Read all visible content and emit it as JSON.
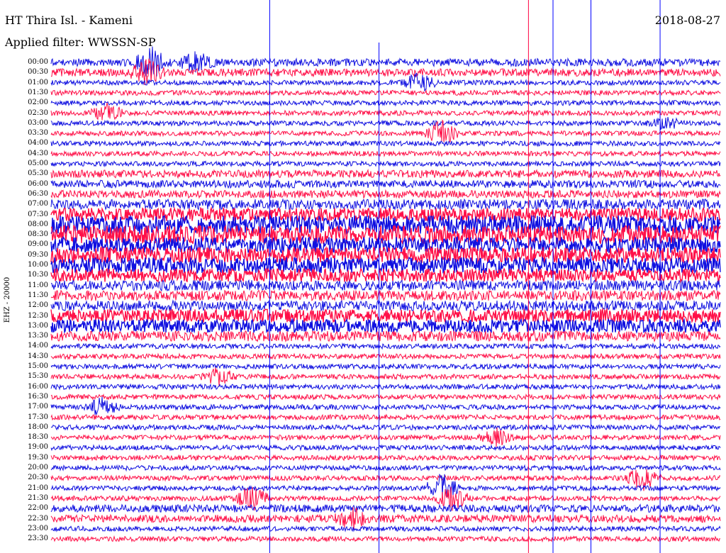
{
  "header": {
    "station": "HT Thira Isl. - Kameni",
    "filter": "Applied filter: WWSSN-SP",
    "date": "2018-08-27"
  },
  "axis": {
    "channel_label": "EHZ - 20000"
  },
  "colors": {
    "blue_trace": "#1010e0",
    "red_trace": "#ff1048",
    "blue_marker": "#0000ff",
    "red_marker": "#ff0040"
  },
  "chart_data": {
    "type": "line",
    "title": "HT Thira Isl. - Kameni",
    "subtitle": "Applied filter: WWSSN-SP",
    "xlabel": "",
    "ylabel": "EHZ - 20000",
    "x_range_minutes": [
      0,
      30
    ],
    "grid": false,
    "legend": "none",
    "rows": [
      "00:00",
      "00:30",
      "01:00",
      "01:30",
      "02:00",
      "02:30",
      "03:00",
      "03:30",
      "04:00",
      "04:30",
      "05:00",
      "05:30",
      "06:00",
      "06:30",
      "07:00",
      "07:30",
      "08:00",
      "08:30",
      "09:00",
      "09:30",
      "10:00",
      "10:30",
      "11:00",
      "11:30",
      "12:00",
      "12:30",
      "13:00",
      "13:30",
      "14:00",
      "14:30",
      "15:00",
      "15:30",
      "16:00",
      "16:30",
      "17:00",
      "17:30",
      "18:00",
      "18:30",
      "19:00",
      "19:30",
      "20:00",
      "20:30",
      "21:00",
      "21:30",
      "22:00",
      "22:30",
      "23:00",
      "23:30"
    ],
    "amplitude_level": [
      2,
      2,
      1,
      1,
      1,
      1,
      1,
      1,
      1,
      1,
      1,
      2,
      2,
      2,
      3,
      4,
      6,
      6,
      5,
      5,
      5,
      4,
      3,
      3,
      3,
      4,
      4,
      3,
      1,
      1,
      1,
      1,
      1,
      1,
      1,
      1,
      1,
      1,
      1,
      1,
      1,
      1,
      1,
      1,
      2,
      2,
      1,
      1
    ],
    "events": [
      {
        "row": 0,
        "minute": 4.5,
        "amp": 5
      },
      {
        "row": 0,
        "minute": 6.5,
        "amp": 3
      },
      {
        "row": 1,
        "minute": 4.3,
        "amp": 4
      },
      {
        "row": 2,
        "minute": 16.5,
        "amp": 3
      },
      {
        "row": 5,
        "minute": 2.5,
        "amp": 3
      },
      {
        "row": 6,
        "minute": 27.5,
        "amp": 2
      },
      {
        "row": 7,
        "minute": 17.5,
        "amp": 4
      },
      {
        "row": 34,
        "minute": 2.3,
        "amp": 3
      },
      {
        "row": 31,
        "minute": 7.5,
        "amp": 3
      },
      {
        "row": 37,
        "minute": 20,
        "amp": 3
      },
      {
        "row": 41,
        "minute": 26.5,
        "amp": 4
      },
      {
        "row": 42,
        "minute": 17.5,
        "amp": 5
      },
      {
        "row": 43,
        "minute": 9,
        "amp": 4
      },
      {
        "row": 43,
        "minute": 18,
        "amp": 4
      },
      {
        "row": 45,
        "minute": 13.5,
        "amp": 3
      }
    ],
    "marker_minutes": {
      "blue": [
        9.8,
        14.7,
        22.5,
        24.2,
        27.3
      ],
      "red": [
        21.4
      ]
    }
  }
}
